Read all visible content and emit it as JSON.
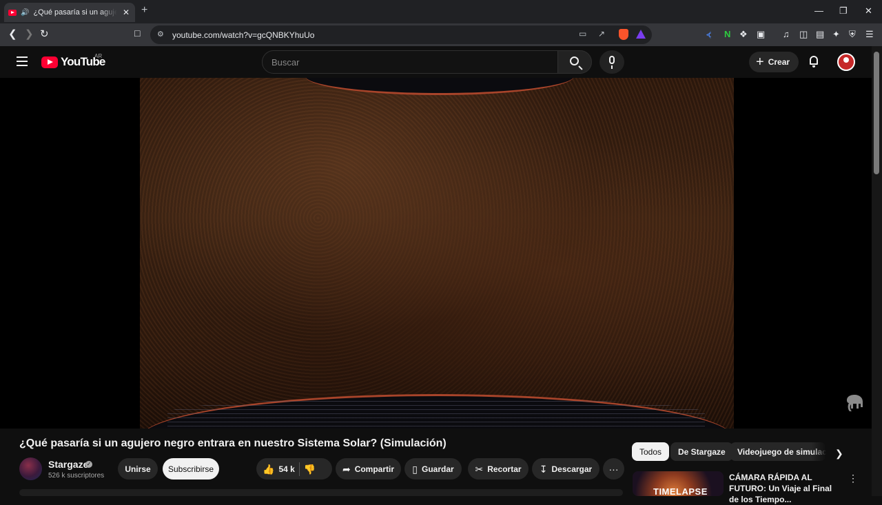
{
  "browser": {
    "tab_title": "¿Qué pasaría si un agujero negro entrara en nuestro Sistema Solar? (Simulación) - YouTube",
    "url": "youtube.com/watch?v=gcQNBKYhuUo",
    "new_tab": "+",
    "close": "✕",
    "minimize": "—",
    "restore": "❐"
  },
  "header": {
    "logo": "YouTube",
    "country_code": "AR",
    "search_placeholder": "Buscar",
    "create_label": "Crear"
  },
  "video": {
    "title": "¿Qué pasaría si un agujero negro entrara en nuestro Sistema Solar? (Simulación)"
  },
  "channel": {
    "name": "Stargaze",
    "subscribers": "526 k suscriptores",
    "join_label": "Unirse",
    "subscribe_label": "Subscribirse"
  },
  "actions": {
    "likes": "54 k",
    "share": "Compartir",
    "save": "Guardar",
    "clip": "Recortar",
    "download": "Descargar"
  },
  "chips": [
    "Todos",
    "De Stargaze",
    "Videojuego de simulación"
  ],
  "recommendation": {
    "thumb_text": "TIMELAPSE",
    "title": "CÁMARA RÁPIDA AL FUTURO: Un Viaje al Final de los Tiempo..."
  }
}
